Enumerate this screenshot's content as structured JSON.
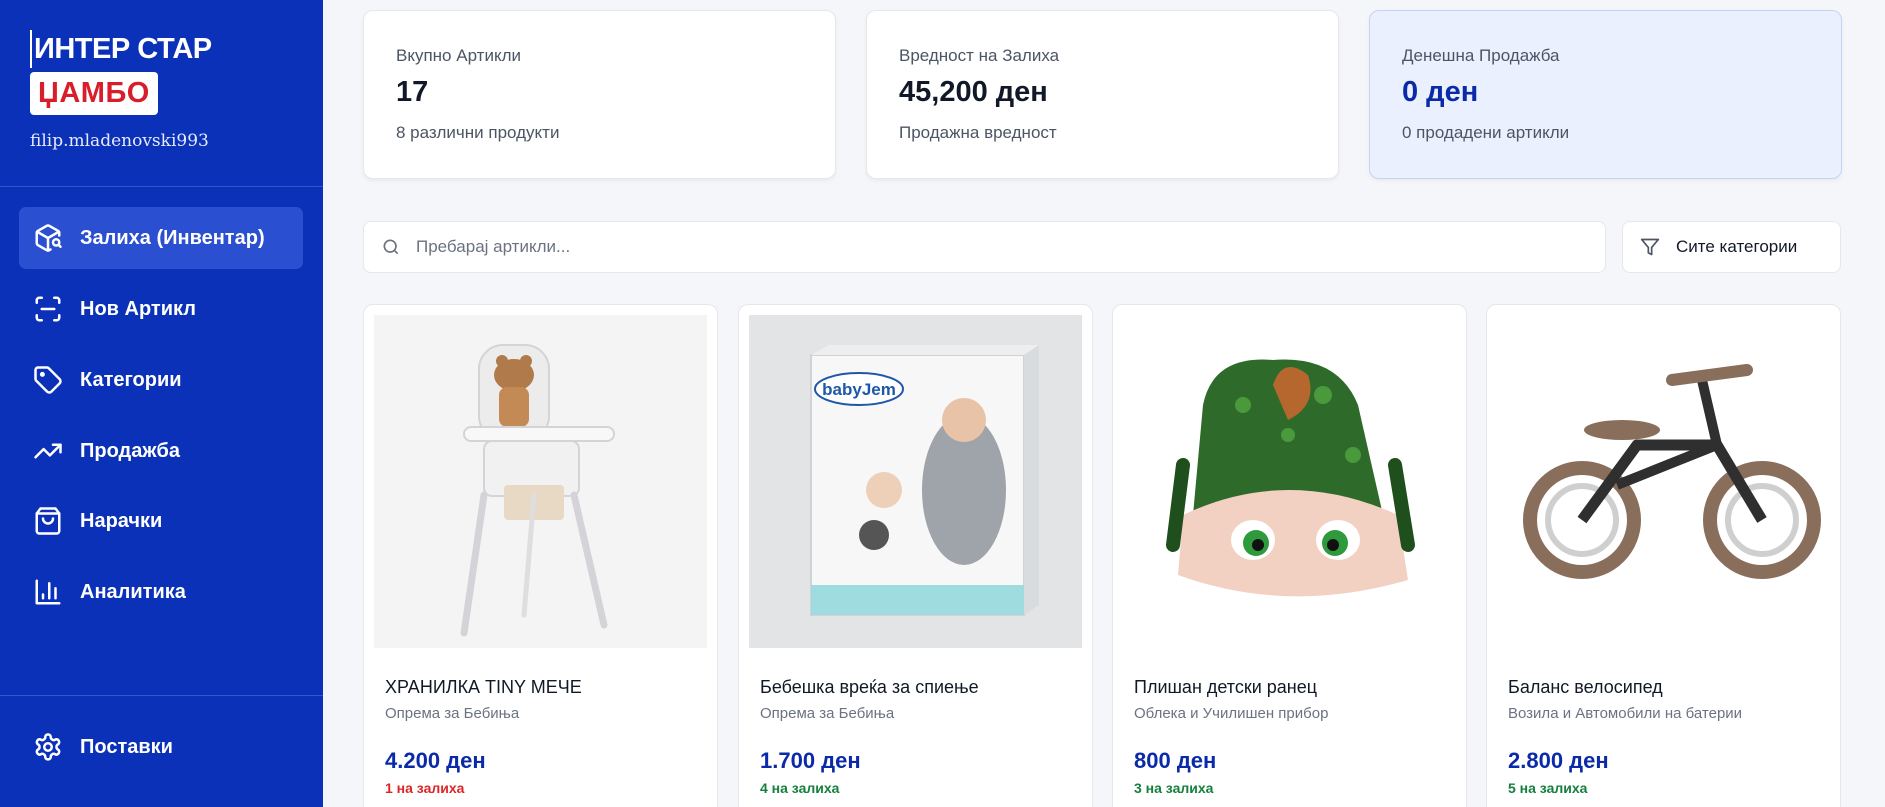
{
  "brand": {
    "title": "ИНТЕР СТАР",
    "logo_text": "ЏАМБО",
    "user": "filip.mladenovski993"
  },
  "sidebar": {
    "items": [
      {
        "label": "Залиха (Инвентар)",
        "icon": "inventory-search-icon",
        "active": true
      },
      {
        "label": "Нов Артикл",
        "icon": "scan-icon",
        "active": false
      },
      {
        "label": "Категории",
        "icon": "tag-icon",
        "active": false
      },
      {
        "label": "Продажба",
        "icon": "trending-up-icon",
        "active": false
      },
      {
        "label": "Нарачки",
        "icon": "shopping-bag-icon",
        "active": false
      },
      {
        "label": "Аналитика",
        "icon": "bar-chart-icon",
        "active": false
      }
    ],
    "settings": {
      "label": "Поставки",
      "icon": "gear-icon"
    }
  },
  "stats": [
    {
      "label": "Вкупно Артикли",
      "value": "17",
      "sub": "8 различни продукти"
    },
    {
      "label": "Вредност на Залиха",
      "value": "45,200 ден",
      "sub": "Продажна вредност"
    },
    {
      "label": "Денешна Продажба",
      "value": "0 ден",
      "sub": "0 продадени артикли"
    }
  ],
  "search": {
    "placeholder": "Пребарај артикли..."
  },
  "filter": {
    "label": "Сите категории"
  },
  "products": [
    {
      "name": "ХРАНИЛКА TINY МЕЧЕ",
      "category": "Опрема за Бебиња",
      "price": "4.200 ден",
      "stock": "1 на залиха",
      "stock_level": "low"
    },
    {
      "name": "Бебешка вреќа за спиење",
      "category": "Опрема за Бебиња",
      "price": "1.700 ден",
      "stock": "4 на залиха",
      "stock_level": "ok"
    },
    {
      "name": "Плишан детски ранец",
      "category": "Облека и Училишен прибор",
      "price": "800 ден",
      "stock": "3 на залиха",
      "stock_level": "ok"
    },
    {
      "name": "Баланс велосипед",
      "category": "Возила и Автомобили на батерии",
      "price": "2.800 ден",
      "stock": "5 на залиха",
      "stock_level": "ok"
    }
  ],
  "product_images": [
    {
      "brand_text": "babyJem"
    }
  ],
  "colors": {
    "sidebar": "#0a31b8",
    "accent": "#0a2aa8",
    "stock_low": "#dc2626",
    "stock_ok": "#15803d"
  }
}
